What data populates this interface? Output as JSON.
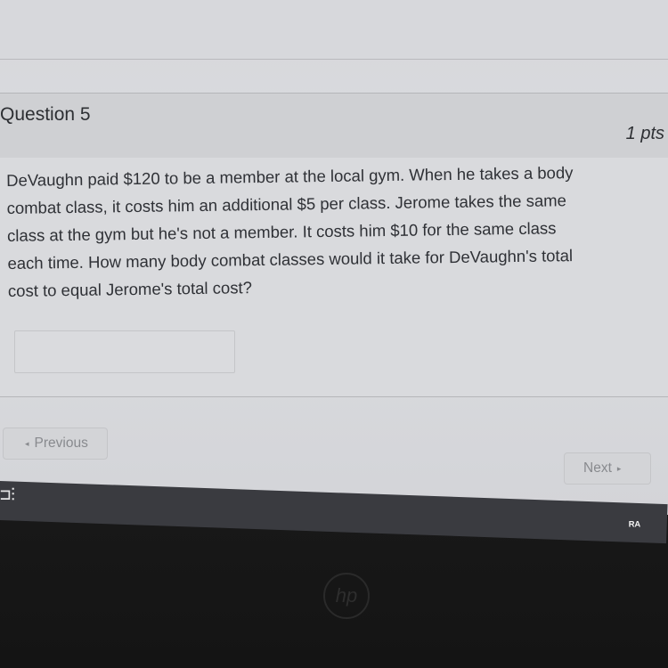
{
  "question": {
    "title": "Question 5",
    "points": "1 pts",
    "lines": [
      "DeVaughn paid $120 to be a member at the local gym. When he takes a body",
      "combat class, it costs him an additional $5 per class. Jerome takes the same",
      "class at the gym but he's not a member. It costs him $10 for the same class",
      "each time. How many body combat classes would it take for DeVaughn's total",
      "cost to equal Jerome's total cost?"
    ],
    "answer_value": ""
  },
  "nav": {
    "previous_label": "Previous",
    "next_label": "Next"
  },
  "taskbar": {
    "left_icon": "⊐⫶",
    "right_icon": "ᴿᴬ"
  },
  "logo_text": "hp"
}
